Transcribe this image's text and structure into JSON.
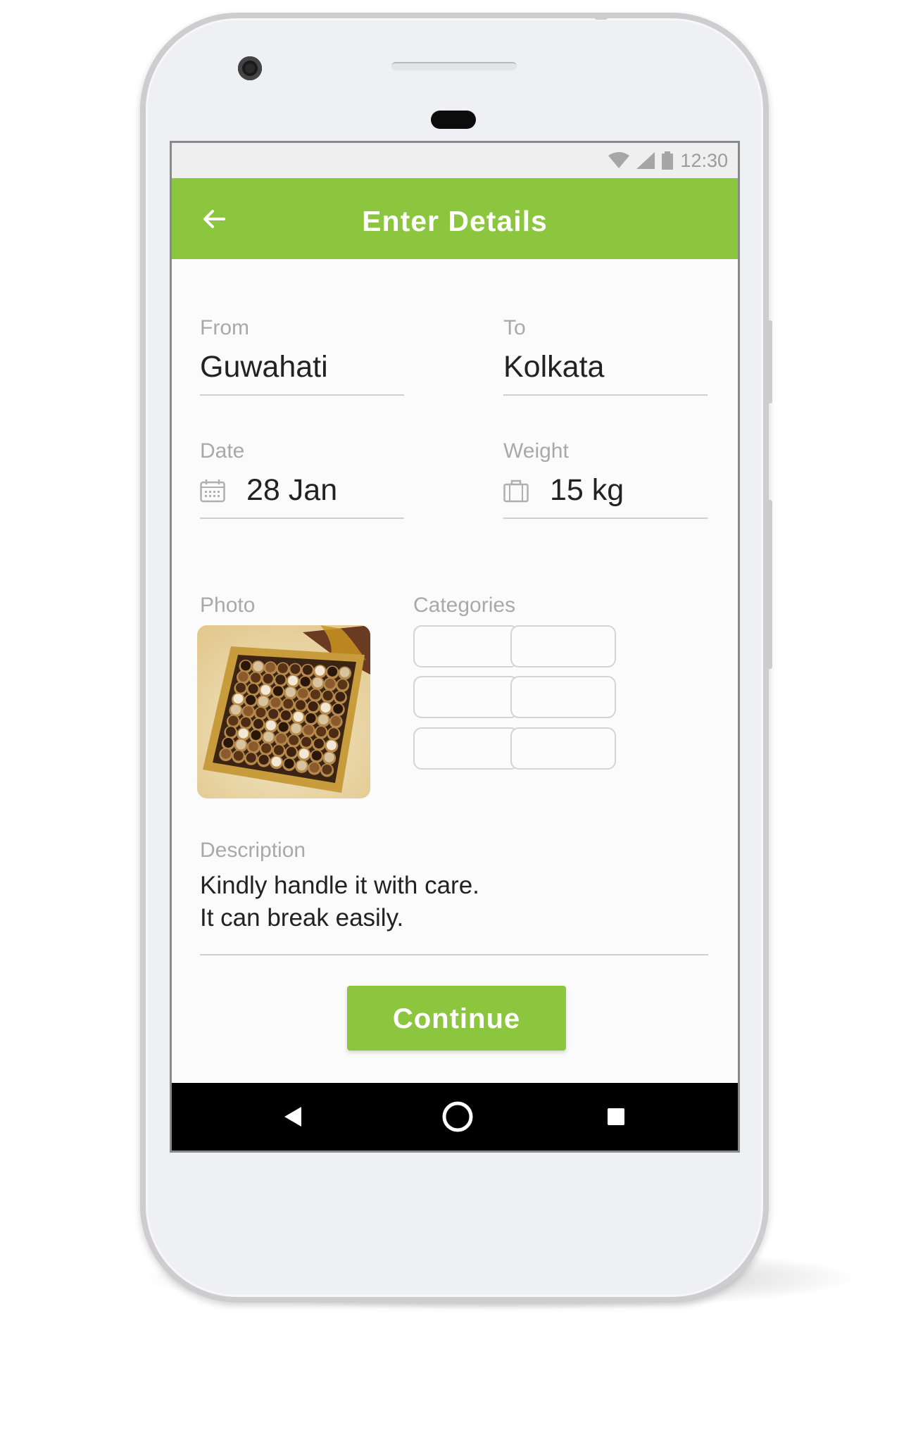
{
  "status_bar": {
    "time": "12:30",
    "icons": [
      "wifi-icon",
      "signal-icon",
      "battery-icon"
    ]
  },
  "app_bar": {
    "title": "Enter Details",
    "back_icon": "arrow-left-icon",
    "color": "#8cc63f"
  },
  "form": {
    "from": {
      "label": "From",
      "value": "Guwahati"
    },
    "to": {
      "label": "To",
      "value": "Kolkata"
    },
    "date": {
      "label": "Date",
      "value": "28 Jan",
      "icon": "calendar-icon"
    },
    "weight": {
      "label": "Weight",
      "value": "15 kg",
      "icon": "luggage-icon"
    },
    "photo": {
      "label": "Photo",
      "description": "box of assorted chocolates"
    },
    "categories": {
      "label": "Categories",
      "boxes": [
        "",
        "",
        "",
        "",
        "",
        ""
      ]
    },
    "description": {
      "label": "Description",
      "lines": [
        "Kindly handle it with care.",
        "It can break easily."
      ]
    }
  },
  "continue_button": {
    "label": "Continue"
  },
  "nav_bar": {
    "icons": [
      "back-triangle-icon",
      "home-circle-icon",
      "recents-square-icon"
    ]
  }
}
